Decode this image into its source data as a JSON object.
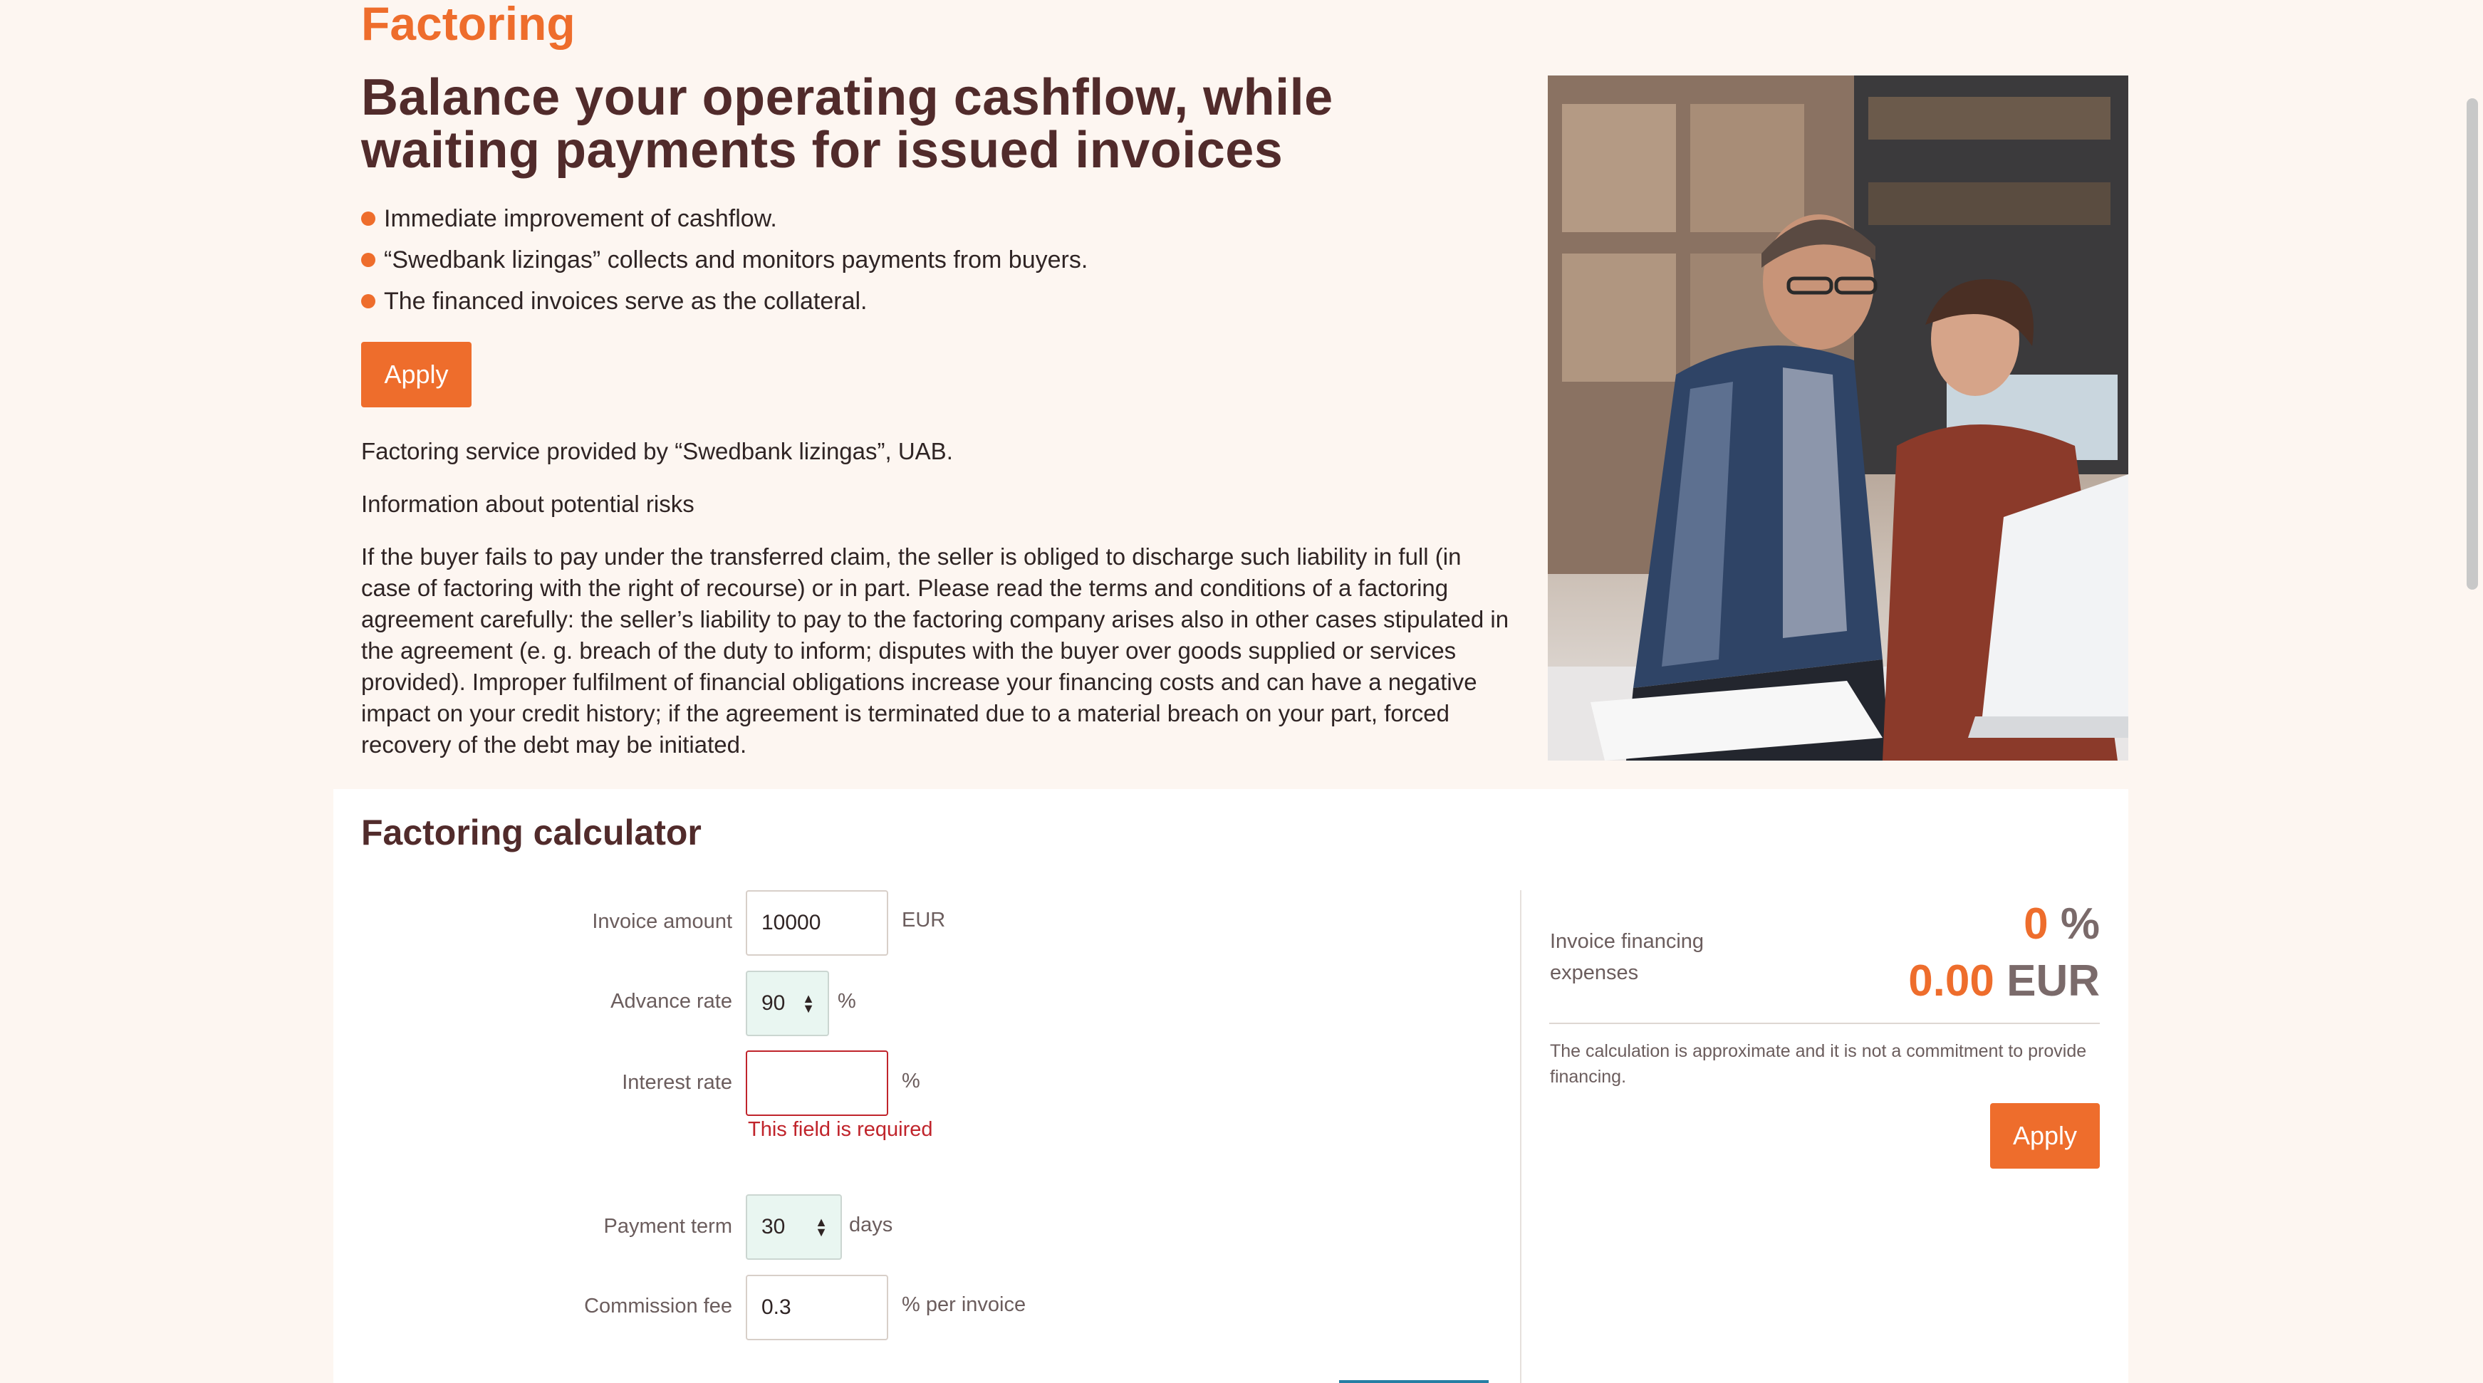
{
  "page": {
    "section_title": "Factoring",
    "headline": "Balance your operating cashflow, while waiting payments for issued invoices",
    "bullets": [
      "Immediate improvement of cashflow.",
      "“Swedbank lizingas” collects and monitors payments from buyers.",
      "The financed invoices serve as the collateral."
    ],
    "apply_label": "Apply",
    "provided_by": "Factoring service provided by “Swedbank lizingas”, UAB.",
    "risks_heading": "Information about potential risks",
    "risks_text": "If the buyer fails to pay under the transferred claim, the seller is obliged to discharge such liability in full (in case of factoring with the right of recourse) or in part. Please read the terms and conditions of a factoring agreement carefully: the seller’s liability to pay to the factoring company arises also in other cases stipulated in the agreement (e. g. breach of the duty to inform; disputes with the buyer over goods supplied or services provided). Improper fulfilment of financial obligations increase your financing costs and can have a negative impact on your credit history; if the agreement is terminated due to a material breach on your part, forced recovery of the debt may be initiated."
  },
  "calculator": {
    "title": "Factoring calculator",
    "invoice_amount": {
      "label": "Invoice amount",
      "value": "10000",
      "unit": "EUR"
    },
    "advance_rate": {
      "label": "Advance rate",
      "value": "90",
      "unit": "%"
    },
    "interest_rate": {
      "label": "Interest rate",
      "value": "",
      "unit": "%",
      "error": "This field is required"
    },
    "payment_term": {
      "label": "Payment term",
      "value": "30",
      "unit": "days"
    },
    "commission_fee": {
      "label": "Commission fee",
      "value": "0.3",
      "unit": "% per invoice"
    },
    "result": {
      "label": "Invoice financing expenses",
      "percent_value": "0",
      "percent_unit": "%",
      "amount_value": "0.00",
      "amount_unit": "EUR",
      "disclaimer": "The calculation is approximate and it is not a commitment to provide financing.",
      "apply_label": "Apply"
    }
  },
  "colors": {
    "accent": "#ee6d2c",
    "heading": "#512b2b",
    "error": "#c0242b",
    "background": "#fdf6f1"
  }
}
